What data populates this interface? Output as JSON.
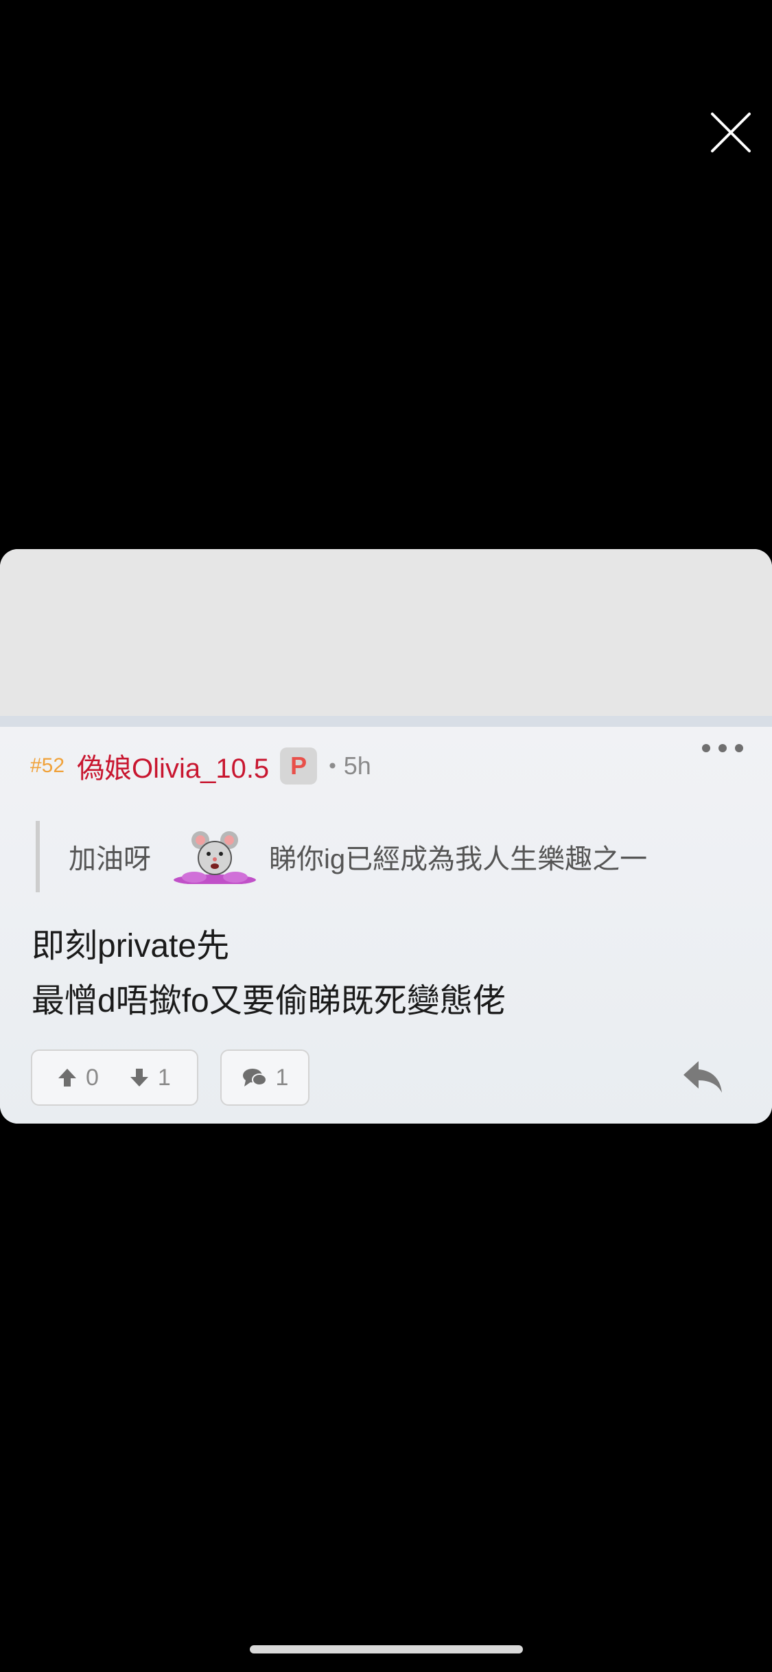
{
  "post": {
    "floor": "#52",
    "username": "偽娘Olivia_10.5",
    "badge": "P",
    "separator": "•",
    "time": "5h",
    "quote": {
      "text_before": "加油呀",
      "emoji_icon": "mouse-emoji-icon",
      "text_after": "睇你ig已經成為我人生樂趣之一"
    },
    "content_lines": [
      "即刻private先",
      "最憎d唔撳fo又要偷睇既死變態佬"
    ],
    "upvotes": "0",
    "downvotes": "1",
    "replies": "1"
  },
  "colors": {
    "floor": "#f0a23a",
    "username": "#c8162f",
    "badge_text": "#e8504a",
    "background": "#000000"
  }
}
